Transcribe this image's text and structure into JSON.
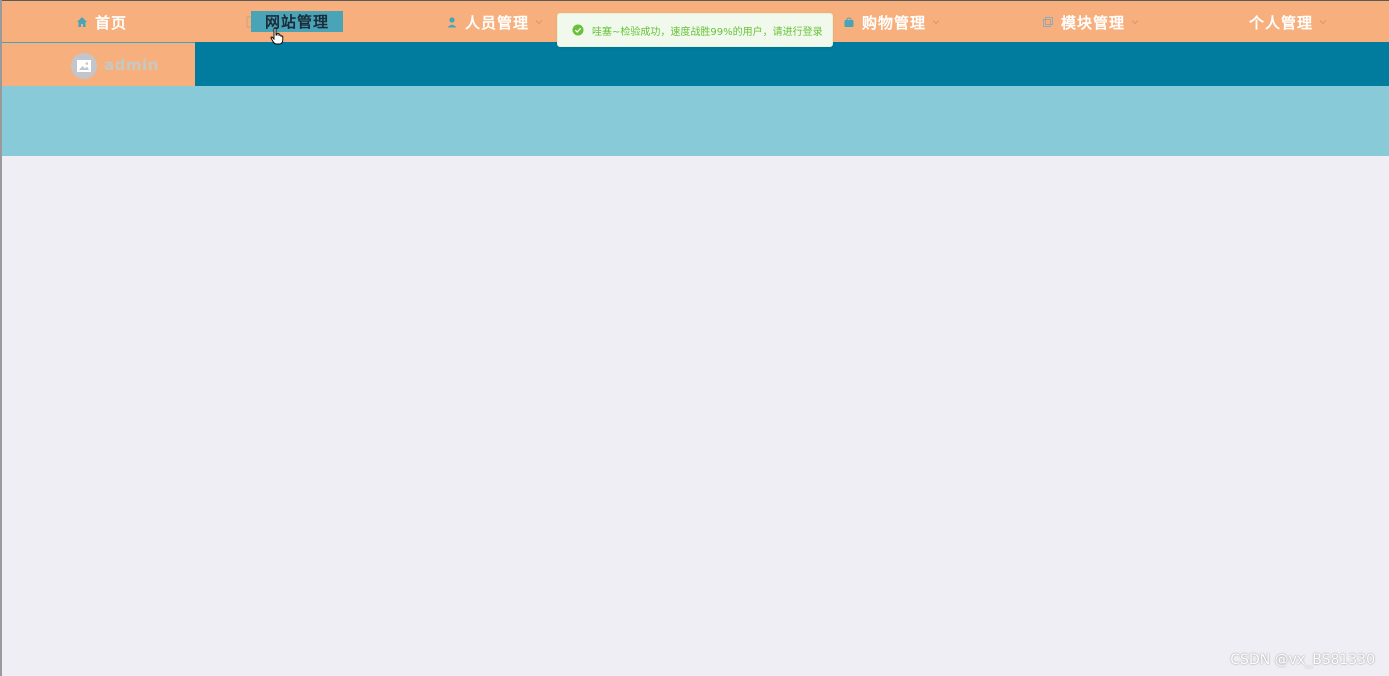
{
  "nav": {
    "items": [
      {
        "label": "首页",
        "icon": "home-icon",
        "has_dropdown": false
      },
      {
        "label": "网站管理",
        "icon": "document-icon",
        "has_dropdown": false
      },
      {
        "label": "人员管理",
        "icon": "user-icon",
        "has_dropdown": true
      },
      {
        "label": "购物管理",
        "icon": "bag-icon",
        "has_dropdown": true
      },
      {
        "label": "模块管理",
        "icon": "copy-icon",
        "has_dropdown": true
      },
      {
        "label": "个人管理",
        "icon": "",
        "has_dropdown": true
      }
    ]
  },
  "user": {
    "name": "admin",
    "avatar_icon": "image-placeholder-icon"
  },
  "toast": {
    "message": "哇塞~检验成功，速度战胜99%的用户，请进行登录",
    "type": "success"
  },
  "watermark": "CSDN @vx_BS81330",
  "colors": {
    "nav_bg": "#f7b07d",
    "subbar_bg": "#017b9e",
    "banner_bg": "#89cad8",
    "content_bg": "#f0eef5",
    "hover_bg": "#4aa4b7",
    "toast_text": "#67c23a"
  }
}
